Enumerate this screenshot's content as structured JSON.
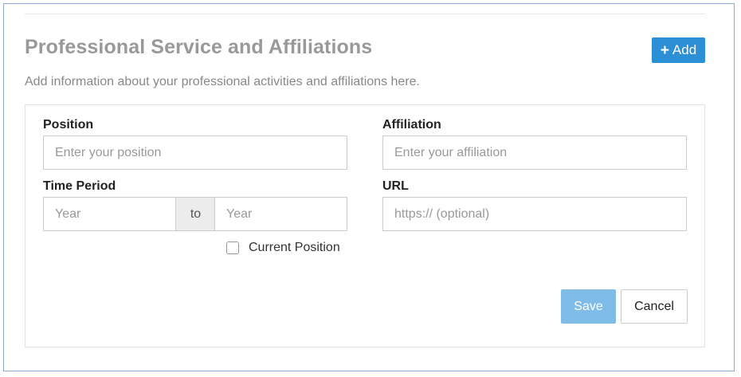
{
  "section": {
    "title": "Professional Service and Affiliations",
    "description": "Add information about your professional activities and affiliations here.",
    "add_icon": "+",
    "add_label": "Add"
  },
  "form": {
    "position": {
      "label": "Position",
      "placeholder": "Enter your position",
      "value": ""
    },
    "affiliation": {
      "label": "Affiliation",
      "placeholder": "Enter your affiliation",
      "value": ""
    },
    "time_period": {
      "label": "Time Period",
      "start_placeholder": "Year",
      "separator": "to",
      "end_placeholder": "Year"
    },
    "url": {
      "label": "URL",
      "placeholder": "https:// (optional)",
      "value": ""
    },
    "current_position": {
      "label": "Current Position",
      "checked": false
    },
    "save_label": "Save",
    "cancel_label": "Cancel"
  },
  "colors": {
    "primary": "#2d8fd5",
    "save_disabled": "#7fbde8",
    "frame_border": "#8fa9d6",
    "title_gray": "#999999"
  }
}
